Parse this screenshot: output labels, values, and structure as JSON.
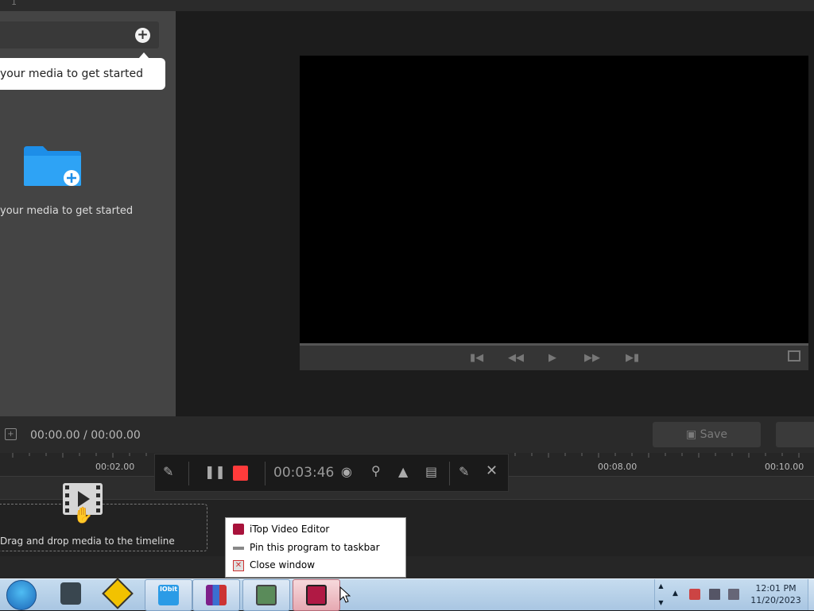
{
  "window": {
    "ruler_top_number": "1"
  },
  "media": {
    "tooltip_text": "your media to get started",
    "empty_text": "your media to get started",
    "add_icon": "plus-icon",
    "collapse_icon": "chevron-left-icon"
  },
  "preview": {
    "controls": [
      "skip-start-icon",
      "rewind-icon",
      "play-icon",
      "fast-forward-icon",
      "skip-end-icon",
      "fullscreen-icon"
    ]
  },
  "status": {
    "timecode": "00:00.00 / 00:00.00",
    "save_label": "Save"
  },
  "timeline": {
    "ticks": [
      "00:02.00",
      "00:08.00",
      "00:10.00"
    ],
    "drop_text": "Drag and drop media to the timeline"
  },
  "recorder": {
    "elapsed": "00:03:46"
  },
  "context_menu": {
    "items": [
      "iTop Video Editor",
      "Pin this program to taskbar",
      "Close window"
    ]
  },
  "taskbar": {
    "time": "12:01 PM",
    "date": "11/20/2023",
    "iobit_label": "IObit"
  },
  "colors": {
    "accent_blue": "#1d8ee8",
    "record_red": "#ff3b3b",
    "panel_gray": "#444444"
  }
}
